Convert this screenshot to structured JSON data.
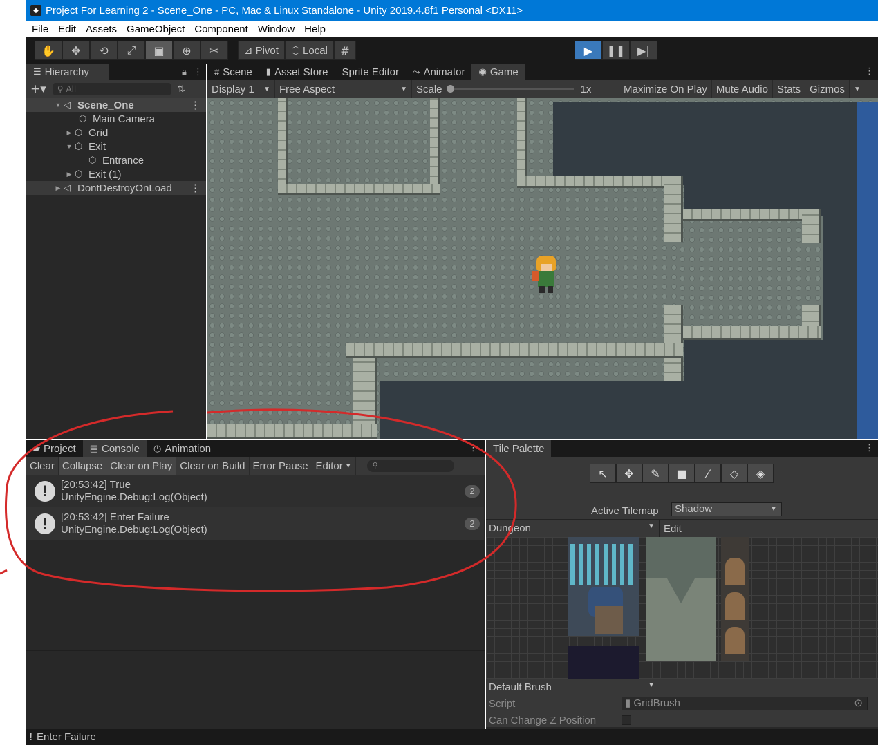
{
  "window": {
    "title": "Project For Learning 2 - Scene_One - PC, Mac & Linux Standalone - Unity 2019.4.8f1 Personal <DX11>"
  },
  "menu": [
    "File",
    "Edit",
    "Assets",
    "GameObject",
    "Component",
    "Window",
    "Help"
  ],
  "toolbar": {
    "pivot_label": "Pivot",
    "local_label": "Local"
  },
  "hierarchy": {
    "tab_label": "Hierarchy",
    "search_placeholder": "All",
    "items": [
      {
        "label": "Scene_One"
      },
      {
        "label": "Main Camera"
      },
      {
        "label": "Grid"
      },
      {
        "label": "Exit"
      },
      {
        "label": "Entrance"
      },
      {
        "label": "Exit (1)"
      },
      {
        "label": "DontDestroyOnLoad"
      }
    ]
  },
  "center_tabs": [
    "Scene",
    "Asset Store",
    "Sprite Editor",
    "Animator",
    "Game"
  ],
  "game_toolbar": {
    "display": "Display 1",
    "aspect": "Free Aspect",
    "scale_label": "Scale",
    "scale_value": "1x",
    "maximize": "Maximize On Play",
    "mute": "Mute Audio",
    "stats": "Stats",
    "gizmos": "Gizmos"
  },
  "bottom_tabs": [
    "Project",
    "Console",
    "Animation"
  ],
  "console": {
    "buttons": [
      "Clear",
      "Collapse",
      "Clear on Play",
      "Clear on Build",
      "Error Pause",
      "Editor"
    ],
    "logs": [
      {
        "line1": "[20:53:42] True",
        "line2": "UnityEngine.Debug:Log(Object)",
        "count": "2"
      },
      {
        "line1": "[20:53:42] Enter Failure",
        "line2": "UnityEngine.Debug:Log(Object)",
        "count": "2"
      }
    ]
  },
  "tile_palette": {
    "tab_label": "Tile Palette",
    "active_tilemap_label": "Active Tilemap",
    "active_tilemap_value": "Shadow",
    "palette_value": "Dungeon",
    "edit_label": "Edit",
    "brush_value": "Default Brush",
    "script_label": "Script",
    "script_value": "GridBrush",
    "can_change_z_label": "Can Change Z Position"
  },
  "status": {
    "message": "Enter Failure"
  }
}
